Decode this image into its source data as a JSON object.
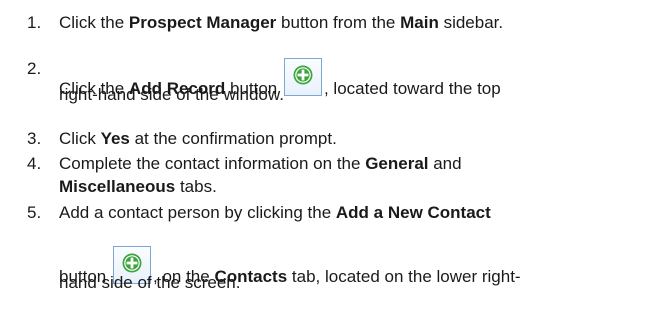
{
  "steps": [
    {
      "number": "1.",
      "line1": {
        "t1": "Click the ",
        "b1": "Prospect Manager",
        "t2": " button from the ",
        "b2": "Main",
        "t3": " sidebar."
      }
    },
    {
      "number": "2.",
      "line1": {
        "t1": "Click the ",
        "b1": "Add Record",
        "t2": " button ",
        "t3": ", located toward the top"
      },
      "line2": "right-hand side of the window.",
      "icon": "add-record-icon"
    },
    {
      "number": "3.",
      "line1": {
        "t1": "Click ",
        "b1": "Yes",
        "t2": " at the confirmation prompt."
      }
    },
    {
      "number": "4.",
      "line1": {
        "t1": "Complete the contact information on the ",
        "b1": "General",
        "t2": " and"
      },
      "line2": {
        "b1": "Miscellaneous",
        "t1": " tabs."
      }
    },
    {
      "number": "5.",
      "line1": {
        "t1": "Add a contact person by clicking the ",
        "b1": "Add a New Contact"
      },
      "line2": {
        "t1": "button ",
        "t2": ", on the ",
        "b1": "Contacts",
        "t3": " tab, located on the lower right-"
      },
      "line3": "hand side of the screen.",
      "icon": "add-contact-icon"
    }
  ],
  "colors": {
    "icon_green": "#3aa53a",
    "icon_border": "#7aa7d6"
  }
}
